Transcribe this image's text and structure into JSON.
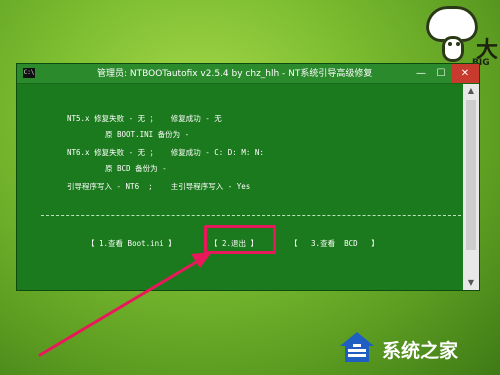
{
  "window": {
    "icon_label": "C:\\",
    "title": "管理员:  NTBOOTautofix v2.5.4 by chz_hlh - NT系统引导高级修复",
    "minimize": "—",
    "maximize": "☐",
    "close": "✕"
  },
  "console": {
    "nt5_line": "NT5.x 修复失败 - 无 ；   修复成功 - 无",
    "nt5_backup": "原 BOOT.INI 备份为 -",
    "nt6_line": "NT6.x 修复失败 - 无 ；   修复成功 - C: D: M: N:",
    "nt6_backup": "原 BCD 备份为 -",
    "bootloader_line": "引导程序写入 - NT6  ;    主引导程序写入 - Yes"
  },
  "menu": {
    "view_boot_ini": "【 1.查看 Boot.ini 】",
    "exit": "【 2.退出 】",
    "view_bcd": "【   3.查看  BCD   】"
  },
  "branding": {
    "mascot_text": "大",
    "mascot_sub": "BIG",
    "watermark_text": "系统之家"
  },
  "colors": {
    "console_bg": "#1b7a1d",
    "highlight": "#e8195a",
    "desktop": "#7fbf32"
  }
}
